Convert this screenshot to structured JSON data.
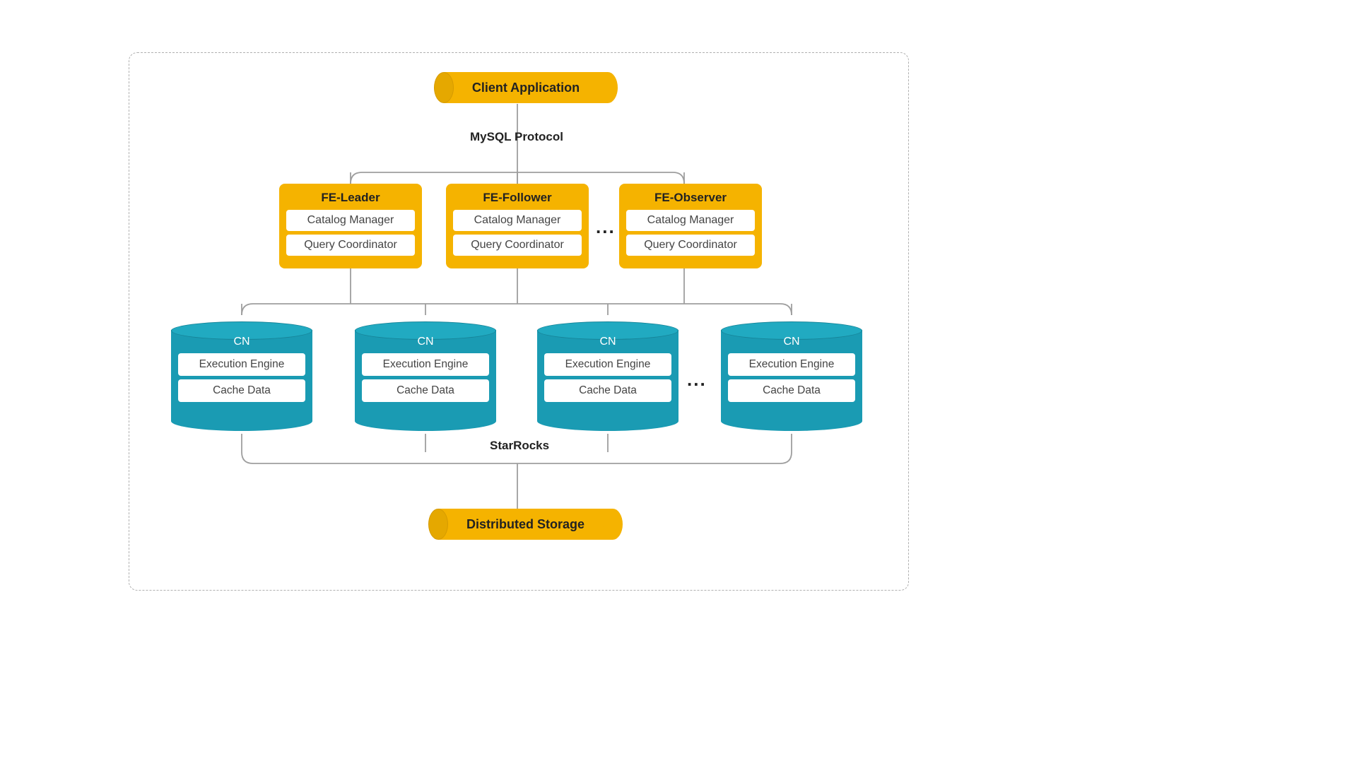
{
  "colors": {
    "yellow": "#f5b300",
    "teal": "#1a9bb3"
  },
  "client": {
    "label": "Client Application"
  },
  "protocol": {
    "label": "MySQL Protocol"
  },
  "fe": {
    "nodes": [
      {
        "title": "FE-Leader",
        "sub1": "Catalog Manager",
        "sub2": "Query Coordinator"
      },
      {
        "title": "FE-Follower",
        "sub1": "Catalog Manager",
        "sub2": "Query Coordinator"
      },
      {
        "title": "FE-Observer",
        "sub1": "Catalog Manager",
        "sub2": "Query Coordinator"
      }
    ],
    "ellipsis": "..."
  },
  "cn": {
    "nodes": [
      {
        "title": "CN",
        "sub1": "Execution Engine",
        "sub2": "Cache Data"
      },
      {
        "title": "CN",
        "sub1": "Execution Engine",
        "sub2": "Cache Data"
      },
      {
        "title": "CN",
        "sub1": "Execution Engine",
        "sub2": "Cache  Data"
      },
      {
        "title": "CN",
        "sub1": "Execution Engine",
        "sub2": "Cache  Data"
      }
    ],
    "ellipsis": "..."
  },
  "cluster_label": "StarRocks",
  "storage": {
    "label": "Distributed Storage"
  }
}
